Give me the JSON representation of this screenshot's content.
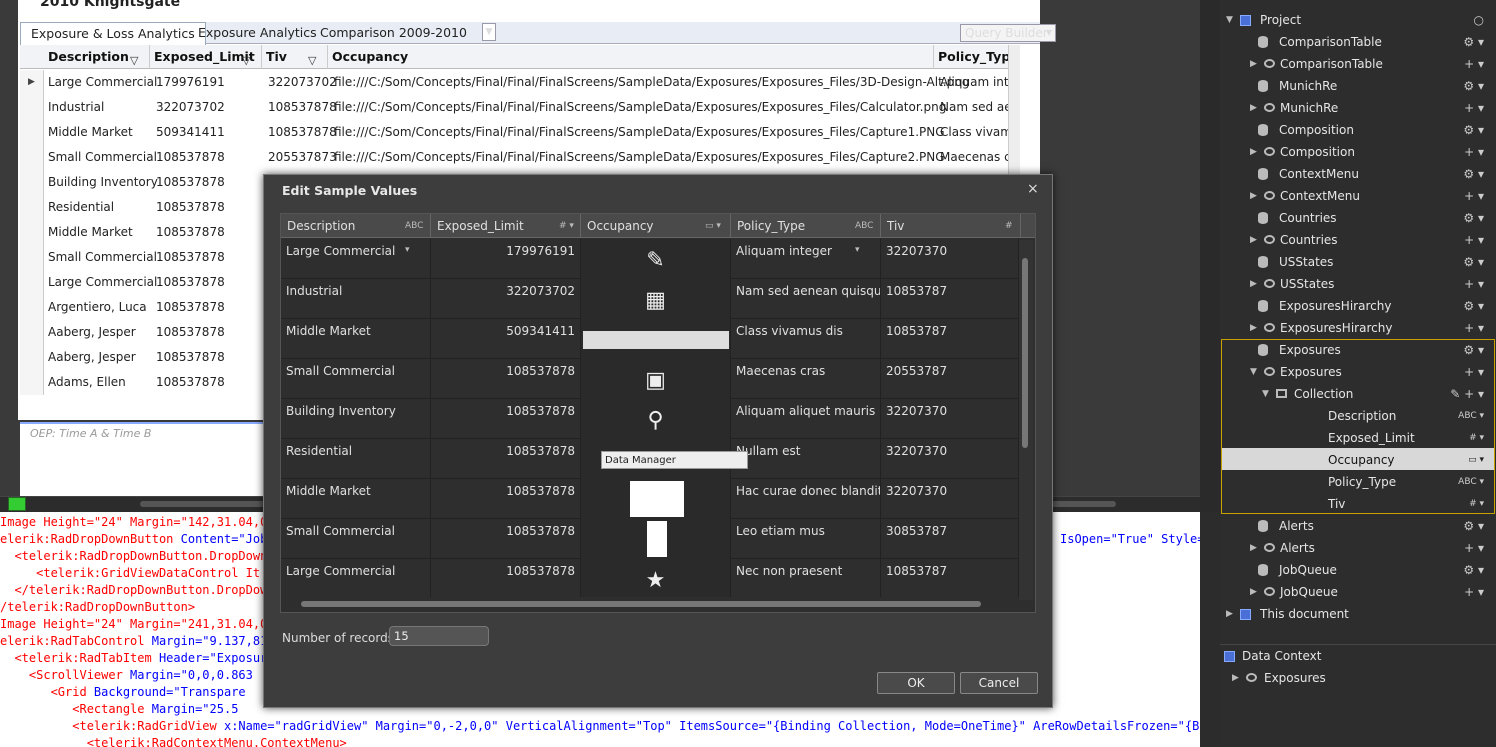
{
  "designer": {
    "artboard_title": "2010 Knightsgate",
    "tabs": [
      "Exposure & Loss Analytics",
      "Exposure Analytics",
      "Comparison 2009-2010"
    ],
    "query_builder": "Query Builder",
    "columns": [
      "Description",
      "Exposed_Limit",
      "Tiv",
      "Occupancy",
      "Policy_Type"
    ],
    "rows": [
      [
        "Large Commercial",
        "179976191",
        "322073702",
        "file:///C:/Som/Concepts/Final/Final/FinalScreens/SampleData/Exposures/Exposures_Files/3D-Design-Alt.png",
        "Aliquam inte"
      ],
      [
        "Industrial",
        "322073702",
        "108537878",
        "file:///C:/Som/Concepts/Final/Final/FinalScreens/SampleData/Exposures/Exposures_Files/Calculator.png",
        "Nam sed aer"
      ],
      [
        "Middle Market",
        "509341411",
        "108537878",
        "file:///C:/Som/Concepts/Final/Final/FinalScreens/SampleData/Exposures/Exposures_Files/Capture1.PNG",
        "Class vivamu"
      ],
      [
        "Small Commercial",
        "108537878",
        "205537873",
        "file:///C:/Som/Concepts/Final/Final/FinalScreens/SampleData/Exposures/Exposures_Files/Capture2.PNG",
        "Maecenas cr"
      ],
      [
        "Building Inventory",
        "108537878",
        "",
        "",
        ""
      ],
      [
        "Residential",
        "108537878",
        "",
        "",
        ""
      ],
      [
        "Middle Market",
        "108537878",
        "",
        "",
        ""
      ],
      [
        "Small Commercial",
        "108537878",
        "",
        "",
        ""
      ],
      [
        "Large Commercial",
        "108537878",
        "",
        "",
        ""
      ],
      [
        "Argentiero, Luca",
        "108537878",
        "",
        "",
        ""
      ],
      [
        "Aaberg, Jesper",
        "108537878",
        "",
        "",
        ""
      ],
      [
        "Aaberg, Jesper",
        "108537878",
        "",
        "",
        ""
      ],
      [
        "Adams, Ellen",
        "108537878",
        "",
        "",
        ""
      ]
    ],
    "chart_title": "OEP: Time A & Time B"
  },
  "xaml": [
    {
      "parts": [
        [
          "r",
          "Image Height=\"24\" Margin=\"142,31.04,0,"
        ]
      ]
    },
    {
      "parts": [
        [
          "r",
          "elerik:RadDropDownButton "
        ],
        [
          "b",
          "Content=\"Job"
        ]
      ],
      "tail": [
        [
          "b",
          "IsOpen=\"True\" Style=\""
        ]
      ]
    },
    {
      "parts": [
        [
          "r",
          "  <telerik:RadDropDownButton.DropDown"
        ]
      ]
    },
    {
      "parts": [
        [
          "r",
          "     <telerik:GridViewDataControl It"
        ]
      ]
    },
    {
      "parts": [
        [
          "r",
          "  </telerik:RadDropDownButton.DropDow"
        ]
      ]
    },
    {
      "parts": [
        [
          "r",
          "/telerik:RadDropDownButton>"
        ]
      ]
    },
    {
      "parts": [
        [
          "r",
          "Image Height=\"24\" Margin=\"241,31.04,0,"
        ]
      ]
    },
    {
      "parts": [
        [
          "r",
          "elerik:RadTabControl "
        ],
        [
          "b",
          "Margin=\"9.137,81"
        ]
      ]
    },
    {
      "parts": [
        [
          "r",
          "  <telerik:RadTabItem "
        ],
        [
          "b",
          "Header=\"Exposur"
        ]
      ]
    },
    {
      "parts": [
        [
          "r",
          "    <ScrollViewer "
        ],
        [
          "b",
          "Margin=\"0,0,0.863"
        ]
      ]
    },
    {
      "parts": [
        [
          "r",
          "       <Grid "
        ],
        [
          "b",
          "Background=\"Transpare"
        ]
      ]
    },
    {
      "parts": [
        [
          "r",
          "          <Rectangle "
        ],
        [
          "b",
          "Margin=\"25.5"
        ]
      ]
    },
    {
      "parts": [
        [
          "r",
          "          <telerik:RadGridView "
        ],
        [
          "b",
          "x:Name=\"radGridView\" Margin=\"0,-2,0,0\" VerticalAlignment=\"Top\" ItemsSource=\"{Binding Collection, Mode=OneTime}\" AreRowDetailsFrozen=\"{Bi"
        ]
      ]
    },
    {
      "parts": [
        [
          "r",
          "            <telerik:RadContextMenu.ContextMenu>"
        ]
      ]
    }
  ],
  "right_panel": {
    "items": [
      {
        "label": "Project",
        "indent": 0,
        "type": "square",
        "twisty": "▼"
      },
      {
        "label": "ComparisonTable",
        "indent": 1,
        "type": "db",
        "twisty": ""
      },
      {
        "label": "ComparisonTable",
        "indent": 2,
        "type": "eye",
        "twisty": "▶"
      },
      {
        "label": "MunichRe",
        "indent": 1,
        "type": "db",
        "twisty": ""
      },
      {
        "label": "MunichRe",
        "indent": 2,
        "type": "eye",
        "twisty": "▶"
      },
      {
        "label": "Composition",
        "indent": 1,
        "type": "db",
        "twisty": ""
      },
      {
        "label": "Composition",
        "indent": 2,
        "type": "eye",
        "twisty": "▶"
      },
      {
        "label": "ContextMenu",
        "indent": 1,
        "type": "db",
        "twisty": ""
      },
      {
        "label": "ContextMenu",
        "indent": 2,
        "type": "eye",
        "twisty": "▶"
      },
      {
        "label": "Countries",
        "indent": 1,
        "type": "db",
        "twisty": ""
      },
      {
        "label": "Countries",
        "indent": 2,
        "type": "eye",
        "twisty": "▶"
      },
      {
        "label": "USStates",
        "indent": 1,
        "type": "db",
        "twisty": ""
      },
      {
        "label": "USStates",
        "indent": 2,
        "type": "eye",
        "twisty": "▶"
      },
      {
        "label": "ExposuresHirarchy",
        "indent": 1,
        "type": "db",
        "twisty": ""
      },
      {
        "label": "ExposuresHirarchy",
        "indent": 2,
        "type": "eye",
        "twisty": "▶"
      },
      {
        "label": "Exposures",
        "indent": 1,
        "type": "db",
        "twisty": ""
      },
      {
        "label": "Exposures",
        "indent": 2,
        "type": "eye",
        "twisty": "▼"
      },
      {
        "label": "Collection",
        "indent": 3,
        "type": "coll",
        "twisty": "▼"
      },
      {
        "label": "Description",
        "indent": 4,
        "type": "field",
        "twisty": "",
        "tag": "ABC"
      },
      {
        "label": "Exposed_Limit",
        "indent": 4,
        "type": "field",
        "twisty": "",
        "tag": "#"
      },
      {
        "label": "Occupancy",
        "indent": 4,
        "type": "field",
        "twisty": "",
        "tag": "▭",
        "selected": true
      },
      {
        "label": "Policy_Type",
        "indent": 4,
        "type": "field",
        "twisty": "",
        "tag": "ABC"
      },
      {
        "label": "Tiv",
        "indent": 4,
        "type": "field",
        "twisty": "",
        "tag": "#"
      },
      {
        "label": "Alerts",
        "indent": 1,
        "type": "db",
        "twisty": ""
      },
      {
        "label": "Alerts",
        "indent": 2,
        "type": "eye",
        "twisty": "▶"
      },
      {
        "label": "JobQueue",
        "indent": 1,
        "type": "db",
        "twisty": ""
      },
      {
        "label": "JobQueue",
        "indent": 2,
        "type": "eye",
        "twisty": "▶"
      },
      {
        "label": "This document",
        "indent": 0,
        "type": "square",
        "twisty": "▶"
      }
    ],
    "data_context_label": "Data Context",
    "data_context_item": "Exposures"
  },
  "dialog": {
    "title": "Edit Sample Values",
    "close": "×",
    "columns": [
      "Description",
      "Exposed_Limit",
      "Occupancy",
      "Policy_Type",
      "Tiv"
    ],
    "rows": [
      [
        "Large Commercial",
        "179976191",
        "✎",
        "Aliquam integer",
        "32207370"
      ],
      [
        "Industrial",
        "322073702",
        "▦",
        "Nam sed aenean quisque",
        "10853787"
      ],
      [
        "Middle Market",
        "509341411",
        "",
        "Class vivamus dis",
        "10853787"
      ],
      [
        "Small Commercial",
        "108537878",
        "▣",
        "Maecenas cras",
        "20553787"
      ],
      [
        "Building Inventory",
        "108537878",
        "⚲",
        "Aliquam aliquet mauris",
        "32207370"
      ],
      [
        "Residential",
        "108537878",
        "",
        "Nullam est",
        "32207370"
      ],
      [
        "Middle Market",
        "108537878",
        "",
        "Hac curae donec blandit",
        "32207370"
      ],
      [
        "Small Commercial",
        "108537878",
        "",
        "Leo etiam mus",
        "30853787"
      ],
      [
        "Large Commercial",
        "108537878",
        "★",
        "Nec non praesent",
        "10853787"
      ]
    ],
    "data_manager_label": "Data Manager",
    "records_label": "Number of records",
    "records_value": "15",
    "ok": "OK",
    "cancel": "Cancel"
  }
}
